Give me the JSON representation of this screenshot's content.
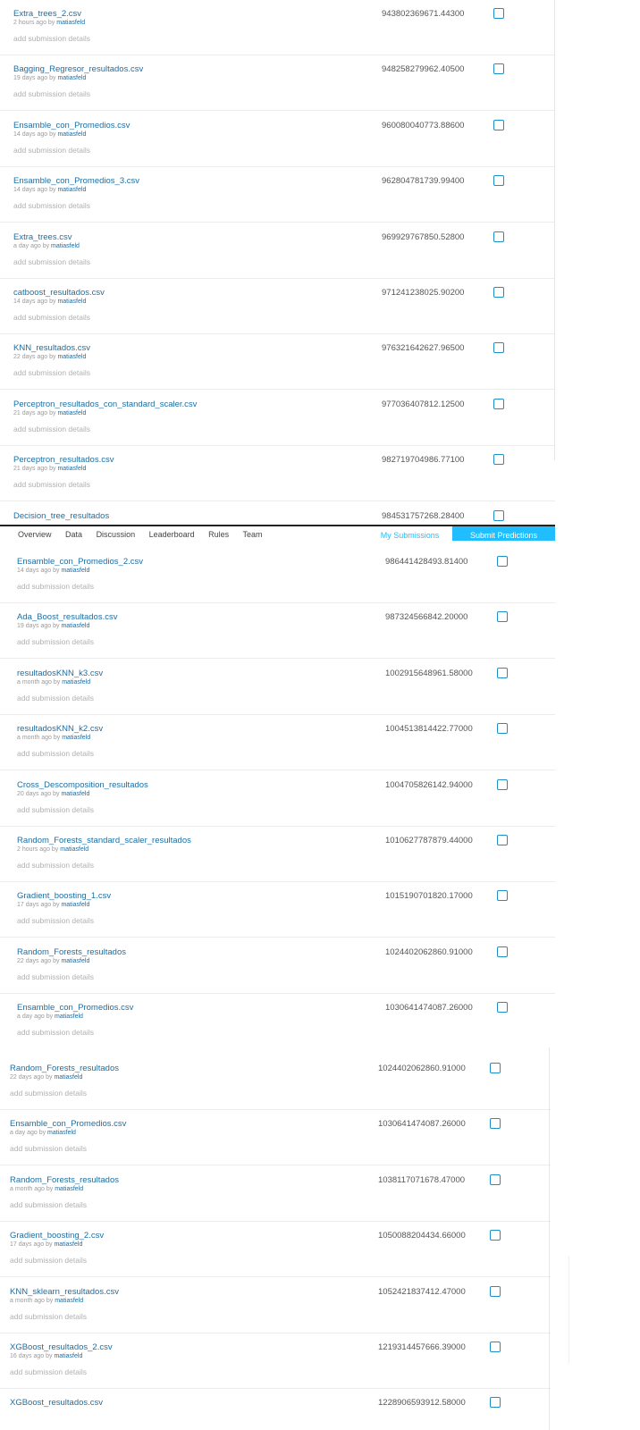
{
  "nav": {
    "tabs": [
      "Overview",
      "Data",
      "Discussion",
      "Leaderboard",
      "Rules",
      "Team"
    ],
    "my_submissions": "My Submissions",
    "submit_predictions": "Submit Predictions"
  },
  "section1": [
    {
      "file": "Extra_trees_2.csv",
      "age": "2 hours ago by",
      "user": "matiasfeld",
      "details": "add submission details",
      "score": "943802369671.44300"
    },
    {
      "file": "Bagging_Regresor_resultados.csv",
      "age": "19 days ago by",
      "user": "matiasfeld",
      "details": "add submission details",
      "score": "948258279962.40500"
    },
    {
      "file": "Ensamble_con_Promedios.csv",
      "age": "14 days ago by",
      "user": "matiasfeld",
      "details": "add submission details",
      "score": "960080040773.88600"
    },
    {
      "file": "Ensamble_con_Promedios_3.csv",
      "age": "14 days ago by",
      "user": "matiasfeld",
      "details": "add submission details",
      "score": "962804781739.99400"
    },
    {
      "file": "Extra_trees.csv",
      "age": "a day ago by",
      "user": "matiasfeld",
      "details": "add submission details",
      "score": "969929767850.52800"
    },
    {
      "file": "catboost_resultados.csv",
      "age": "14 days ago by",
      "user": "matiasfeld",
      "details": "add submission details",
      "score": "971241238025.90200"
    },
    {
      "file": "KNN_resultados.csv",
      "age": "22 days ago by",
      "user": "matiasfeld",
      "details": "add submission details",
      "score": "976321642627.96500"
    },
    {
      "file": "Perceptron_resultados_con_standard_scaler.csv",
      "age": "21 days ago by",
      "user": "matiasfeld",
      "details": "add submission details",
      "score": "977036407812.12500"
    },
    {
      "file": "Perceptron_resultados.csv",
      "age": "21 days ago by",
      "user": "matiasfeld",
      "details": "add submission details",
      "score": "982719704986.77100"
    },
    {
      "file": "Decision_tree_resultados",
      "age": "",
      "user": "",
      "details": "",
      "score": "984531757268.28400"
    }
  ],
  "section2": [
    {
      "file": "Ensamble_con_Promedios_2.csv",
      "age": "14 days ago by",
      "user": "matiasfeld",
      "details": "add submission details",
      "score": "986441428493.81400"
    },
    {
      "file": "Ada_Boost_resultados.csv",
      "age": "19 days ago by",
      "user": "matiasfeld",
      "details": "add submission details",
      "score": "987324566842.20000"
    },
    {
      "file": "resultadosKNN_k3.csv",
      "age": "a month ago by",
      "user": "matiasfeld",
      "details": "add submission details",
      "score": "1002915648961.58000"
    },
    {
      "file": "resultadosKNN_k2.csv",
      "age": "a month ago by",
      "user": "matiasfeld",
      "details": "add submission details",
      "score": "1004513814422.77000"
    },
    {
      "file": "Cross_Descomposition_resultados",
      "age": "20 days ago by",
      "user": "matiasfeld",
      "details": "add submission details",
      "score": "1004705826142.94000"
    },
    {
      "file": "Random_Forests_standard_scaler_resultados",
      "age": "2 hours ago by",
      "user": "matiasfeld",
      "details": "add submission details",
      "score": "1010627787879.44000"
    },
    {
      "file": "Gradient_boosting_1.csv",
      "age": "17 days ago by",
      "user": "matiasfeld",
      "details": "add submission details",
      "score": "1015190701820.17000"
    },
    {
      "file": "Random_Forests_resultados",
      "age": "22 days ago by",
      "user": "matiasfeld",
      "details": "add submission details",
      "score": "1024402062860.91000"
    },
    {
      "file": "Ensamble_con_Promedios.csv",
      "age": "a day ago by",
      "user": "matiasfeld",
      "details": "add submission details",
      "score": "1030641474087.26000"
    }
  ],
  "section3": [
    {
      "file": "Random_Forests_resultados",
      "age": "22 days ago by",
      "user": "matiasfeld",
      "details": "add submission details",
      "score": "1024402062860.91000"
    },
    {
      "file": "Ensamble_con_Promedios.csv",
      "age": "a day ago by",
      "user": "matiasfeld",
      "details": "add submission details",
      "score": "1030641474087.26000"
    },
    {
      "file": "Random_Forests_resultados",
      "age": "a month ago by",
      "user": "matiasfeld",
      "details": "add submission details",
      "score": "1038117071678.47000"
    },
    {
      "file": "Gradient_boosting_2.csv",
      "age": "17 days ago by",
      "user": "matiasfeld",
      "details": "add submission details",
      "score": "1050088204434.66000"
    },
    {
      "file": "KNN_sklearn_resultados.csv",
      "age": "a month ago by",
      "user": "matiasfeld",
      "details": "add submission details",
      "score": "1052421837412.47000"
    },
    {
      "file": "XGBoost_resultados_2.csv",
      "age": "16 days ago by",
      "user": "matiasfeld",
      "details": "add submission details",
      "score": "1219314457666.39000"
    },
    {
      "file": "XGBoost_resultados.csv",
      "age": "",
      "user": "",
      "details": "",
      "score": "1228906593912.58000"
    }
  ]
}
